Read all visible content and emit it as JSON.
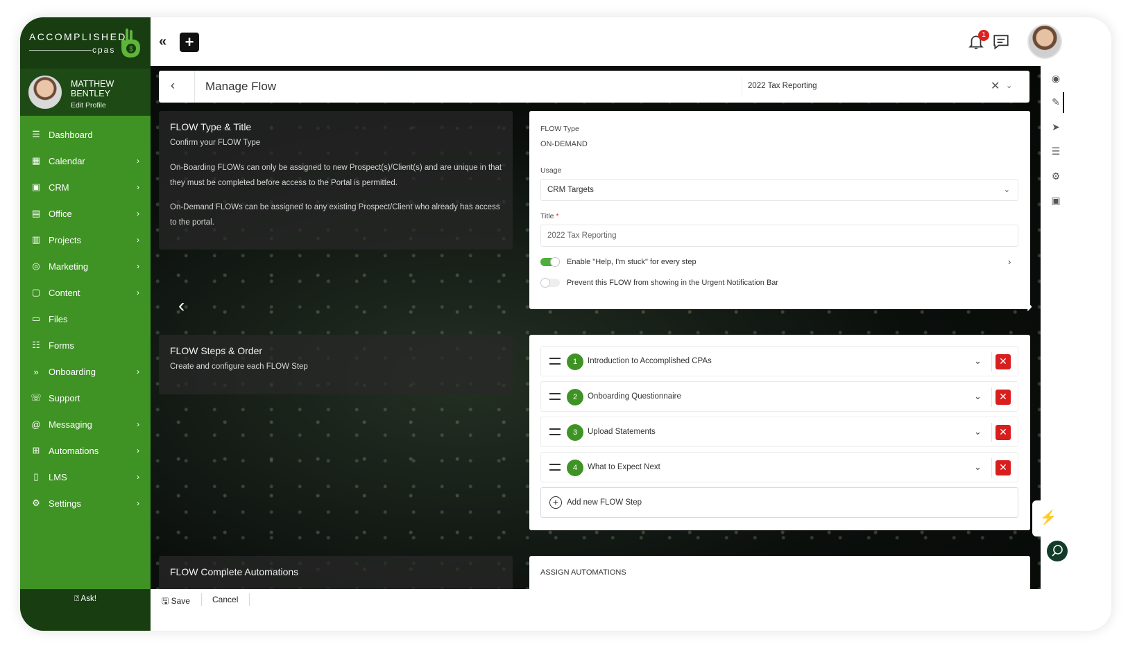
{
  "brand": {
    "word": "ACCOMPLISHED",
    "sub": "cpas"
  },
  "profile": {
    "name": "MATTHEW BENTLEY",
    "edit": "Edit Profile"
  },
  "sidebar": {
    "items": [
      {
        "label": "Dashboard",
        "icon": "dashboard-icon",
        "chevron": false
      },
      {
        "label": "Calendar",
        "icon": "calendar-icon",
        "chevron": true
      },
      {
        "label": "CRM",
        "icon": "crm-icon",
        "chevron": true
      },
      {
        "label": "Office",
        "icon": "office-icon",
        "chevron": true
      },
      {
        "label": "Projects",
        "icon": "projects-icon",
        "chevron": true
      },
      {
        "label": "Marketing",
        "icon": "marketing-icon",
        "chevron": true
      },
      {
        "label": "Content",
        "icon": "content-icon",
        "chevron": true
      },
      {
        "label": "Files",
        "icon": "folder-icon",
        "chevron": false
      },
      {
        "label": "Forms",
        "icon": "forms-icon",
        "chevron": false
      },
      {
        "label": "Onboarding",
        "icon": "onboarding-icon",
        "chevron": true
      },
      {
        "label": "Support",
        "icon": "support-icon",
        "chevron": false
      },
      {
        "label": "Messaging",
        "icon": "at-icon",
        "chevron": true
      },
      {
        "label": "Automations",
        "icon": "automations-icon",
        "chevron": true
      },
      {
        "label": "LMS",
        "icon": "book-icon",
        "chevron": true
      },
      {
        "label": "Settings",
        "icon": "gear-icon",
        "chevron": true
      }
    ],
    "ask": "Ask!"
  },
  "topbar": {
    "notification_count": "1"
  },
  "page": {
    "title": "Manage Flow",
    "flow_select": "2022 Tax Reporting"
  },
  "type_card": {
    "title": "FLOW Type & Title",
    "subtitle": "Confirm your FLOW Type",
    "p1": "On-Boarding FLOWs can only be assigned to new Prospect(s)/Client(s) and are unique in that they must be completed before access to the Portal is permitted.",
    "p2": "On-Demand FLOWs can be assigned to any existing Prospect/Client who already has access to the portal."
  },
  "form": {
    "flow_type_label": "FLOW Type",
    "flow_type_value": "ON-DEMAND",
    "usage_label": "Usage",
    "usage_value": "CRM Targets",
    "title_label": "Title",
    "title_required": "*",
    "title_value": "2022 Tax Reporting",
    "toggle_help": "Enable \"Help, I'm stuck\" for every step",
    "toggle_help_on": true,
    "toggle_urgent": "Prevent this FLOW from showing in the Urgent Notification Bar",
    "toggle_urgent_on": false
  },
  "steps_card": {
    "title": "FLOW Steps & Order",
    "subtitle": "Create and configure each FLOW Step"
  },
  "steps": [
    {
      "num": "1",
      "name": "Introduction to Accomplished CPAs"
    },
    {
      "num": "2",
      "name": "Onboarding Questionnaire"
    },
    {
      "num": "3",
      "name": "Upload Statements"
    },
    {
      "num": "4",
      "name": "What to Expect Next"
    }
  ],
  "add_step": "Add new FLOW Step",
  "automations_card": {
    "title": "FLOW Complete Automations"
  },
  "assign": {
    "title": "ASSIGN AUTOMATIONS"
  },
  "bottombar": {
    "save": "Save",
    "cancel": "Cancel"
  },
  "colors": {
    "sidebar_green": "#3f9324",
    "dark_green": "#173d10",
    "delete_red": "#d91e1e"
  }
}
